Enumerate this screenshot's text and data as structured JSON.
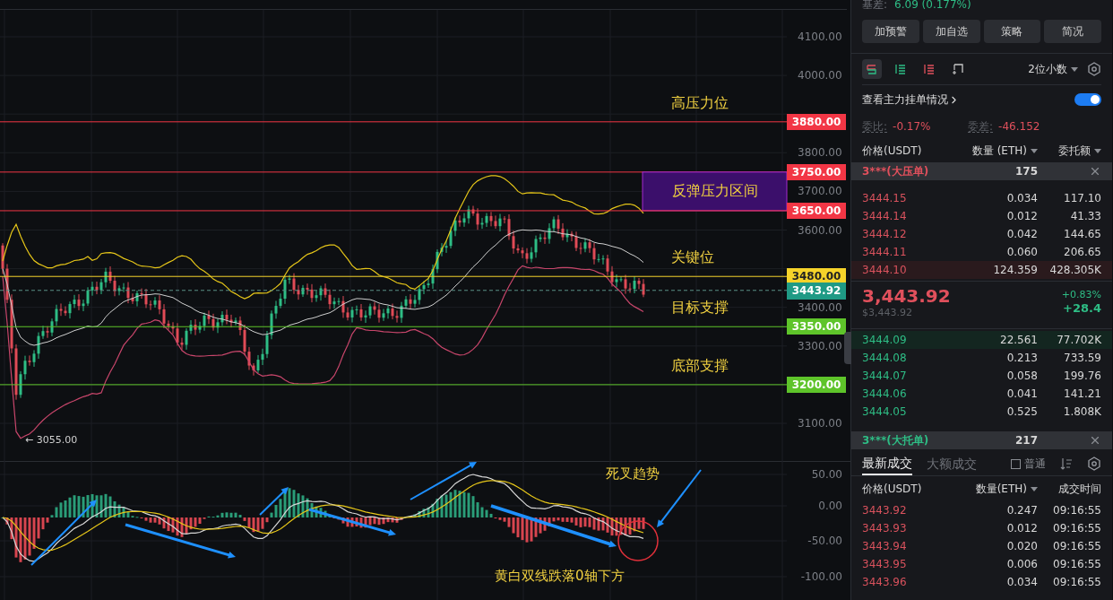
{
  "chart": {
    "price_ticks": [
      "4100.00",
      "4000.00",
      "3800.00",
      "3700.00",
      "3600.00",
      "3400.00",
      "3300.00",
      "3100.00"
    ],
    "levels": [
      {
        "price": "3880.00",
        "color": "#f23645",
        "kind": "line",
        "note": "高压力位"
      },
      {
        "price": "3750.00",
        "color": "#f23645",
        "kind": "zone",
        "note": "反弹压力区间"
      },
      {
        "price": "3650.00",
        "color": "#f23645",
        "kind": "line"
      },
      {
        "price": "3480.00",
        "color": "#f5d32a",
        "kind": "line",
        "note": "关键位"
      },
      {
        "price": "3350.00",
        "color": "#5ec42a",
        "kind": "line",
        "note": "目标支撑"
      },
      {
        "price": "3200.00",
        "color": "#5ec42a",
        "kind": "line",
        "note": "底部支撑"
      }
    ],
    "current_price": "3443.92",
    "low_marker": "← 3055.00"
  },
  "macd": {
    "ticks": [
      "50.00",
      "0.00",
      "-50.00",
      "-100.00"
    ],
    "cross_note": "死叉趋势",
    "zero_note": "黄白双线跌落0轴下方"
  },
  "panel": {
    "basis": {
      "label": "基差:",
      "value": "6.09 (0.177%)"
    },
    "buttons": [
      "加预警",
      "加自选",
      "策略",
      "简况"
    ],
    "views": [
      {
        "selected": true
      },
      {
        "selected": false
      },
      {
        "selected": false
      },
      {
        "selected": false
      }
    ],
    "decimals": "2位小数",
    "main_orders": {
      "label": "查看主力挂单情况",
      "on": true
    },
    "ratio": {
      "label": "委比:",
      "value": "-0.17%"
    },
    "diff": {
      "label": "委差:",
      "value": "-46.152"
    },
    "book_columns": [
      "价格(USDT)",
      "数量 (ETH)",
      "委托额"
    ],
    "big_ask": {
      "label": "3***(大压单)",
      "qty": "175"
    },
    "asks": [
      {
        "price": "3444.15",
        "qty": "0.034",
        "amount": "117.10",
        "highlighted": false
      },
      {
        "price": "3444.14",
        "qty": "0.012",
        "amount": "41.33",
        "highlighted": false
      },
      {
        "price": "3444.12",
        "qty": "0.042",
        "amount": "144.65",
        "highlighted": false
      },
      {
        "price": "3444.11",
        "qty": "0.060",
        "amount": "206.65",
        "highlighted": false
      },
      {
        "price": "3444.10",
        "qty": "124.359",
        "amount": "428.305K",
        "highlighted": true
      }
    ],
    "last": {
      "price": "3,443.92",
      "usd": "$3,443.92",
      "change_pct": "+0.83%",
      "change": "+28.4"
    },
    "bids": [
      {
        "price": "3444.09",
        "qty": "22.561",
        "amount": "77.702K",
        "highlighted": true
      },
      {
        "price": "3444.08",
        "qty": "0.213",
        "amount": "733.59",
        "highlighted": false
      },
      {
        "price": "3444.07",
        "qty": "0.058",
        "amount": "199.76",
        "highlighted": false
      },
      {
        "price": "3444.06",
        "qty": "0.041",
        "amount": "141.21",
        "highlighted": false
      },
      {
        "price": "3444.05",
        "qty": "0.525",
        "amount": "1.808K",
        "highlighted": false
      }
    ],
    "big_bid": {
      "label": "3***(大托单)",
      "qty": "217"
    },
    "trade_tabs": [
      {
        "label": "最新成交",
        "selected": true
      },
      {
        "label": "大额成交",
        "selected": false
      }
    ],
    "normal": {
      "label": "普通",
      "checked": false
    },
    "trade_columns": [
      "价格(USDT)",
      "数量(ETH)",
      "成交时间"
    ],
    "trades": [
      {
        "price": "3443.92",
        "qty": "0.247",
        "time": "09:16:55"
      },
      {
        "price": "3443.93",
        "qty": "0.012",
        "time": "09:16:55"
      },
      {
        "price": "3443.94",
        "qty": "0.020",
        "time": "09:16:55"
      },
      {
        "price": "3443.95",
        "qty": "0.006",
        "time": "09:16:55"
      },
      {
        "price": "3443.96",
        "qty": "0.034",
        "time": "09:16:55"
      }
    ]
  }
}
